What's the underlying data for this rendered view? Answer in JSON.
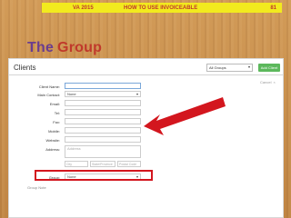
{
  "banner": {
    "left": "VA 2015",
    "middle": "HOW TO USE INVOICEABLE",
    "right": "81"
  },
  "heading": {
    "word1": "The",
    "word2": "Group"
  },
  "panel": {
    "title": "Clients",
    "groups_select": "All Groups",
    "add_button": "Add Client",
    "cancel_label": "Cancel",
    "form": {
      "client_name": {
        "label": "Client Name:",
        "value": ""
      },
      "main_contact": {
        "label": "Main Contact:",
        "value": "None"
      },
      "email": {
        "label": "Email:",
        "value": ""
      },
      "tel": {
        "label": "Tel:",
        "value": ""
      },
      "fax": {
        "label": "Fax:",
        "value": ""
      },
      "mobile": {
        "label": "Mobile:",
        "value": ""
      },
      "website": {
        "label": "Website:",
        "value": ""
      },
      "address": {
        "label": "Address:",
        "placeholder": "Address"
      },
      "city": {
        "placeholder": "City"
      },
      "state": {
        "placeholder": "State/Province"
      },
      "postal": {
        "placeholder": "Postal Code"
      },
      "group": {
        "label": "Group:",
        "value": "None"
      },
      "notes": {
        "label": "Group Note"
      }
    }
  },
  "colors": {
    "banner_bg": "#f2ea1e",
    "banner_text": "#c0392b",
    "the_color": "#6a3d8f",
    "group_color": "#c0392b",
    "highlight_red": "#d3161e",
    "add_green": "#5cb85c"
  }
}
